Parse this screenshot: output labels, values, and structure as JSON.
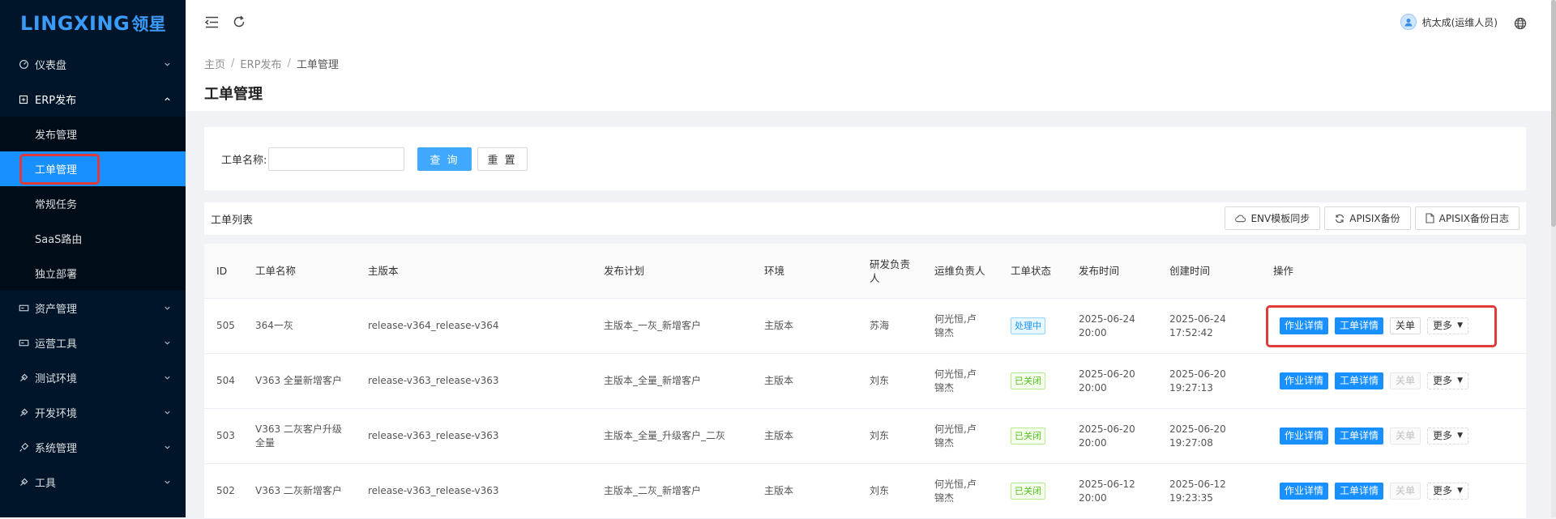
{
  "logo": {
    "text": "LINGXING",
    "cn": "领星"
  },
  "sidebar": {
    "items": [
      {
        "label": "仪表盘",
        "icon": "dashboard-icon",
        "expanded": false
      },
      {
        "label": "ERP发布",
        "icon": "erp-icon",
        "expanded": true,
        "children": [
          "发布管理",
          "工单管理",
          "常规任务",
          "SaaS路由",
          "独立部署"
        ],
        "active_child": "工单管理"
      },
      {
        "label": "资产管理",
        "icon": "asset-icon",
        "expanded": false
      },
      {
        "label": "运营工具",
        "icon": "ops-tool-icon",
        "expanded": false
      },
      {
        "label": "测试环境",
        "icon": "test-env-icon",
        "expanded": false
      },
      {
        "label": "开发环境",
        "icon": "dev-env-icon",
        "expanded": false
      },
      {
        "label": "系统管理",
        "icon": "system-icon",
        "expanded": false
      },
      {
        "label": "工具",
        "icon": "tools-icon",
        "expanded": false
      }
    ]
  },
  "header": {
    "user": "杭太成(运维人员)"
  },
  "breadcrumb": [
    "主页",
    "ERP发布",
    "工单管理"
  ],
  "page_title": "工单管理",
  "search": {
    "label": "工单名称:",
    "value": "",
    "query_btn": "查 询",
    "reset_btn": "重 置"
  },
  "toolbar": {
    "title": "工单列表",
    "buttons": [
      "ENV模板同步",
      "APISIX备份",
      "APISIX备份日志"
    ]
  },
  "table": {
    "columns": [
      "ID",
      "工单名称",
      "主版本",
      "发布计划",
      "环境",
      "研发负责人",
      "运维负责人",
      "工单状态",
      "发布时间",
      "创建时间",
      "操作"
    ],
    "rows": [
      {
        "id": "505",
        "name": "364一灰",
        "version": "release-v364_release-v364",
        "plan": "主版本_一灰_新增客户",
        "env": "主版本",
        "dev": "苏海",
        "ops": "何光恒,卢锦杰",
        "status": "处理中",
        "status_type": "proc",
        "release_time": "2025-06-24 20:00",
        "created": "2025-06-24 17:52:42",
        "close_disabled": false
      },
      {
        "id": "504",
        "name": "V363 全量新增客户",
        "version": "release-v363_release-v363",
        "plan": "主版本_全量_新增客户",
        "env": "主版本",
        "dev": "刘东",
        "ops": "何光恒,卢锦杰",
        "status": "已关闭",
        "status_type": "closed",
        "release_time": "2025-06-20 20:00",
        "created": "2025-06-20 19:27:13",
        "close_disabled": true
      },
      {
        "id": "503",
        "name": "V363 二灰客户升级全量",
        "version": "release-v363_release-v363",
        "plan": "主版本_全量_升级客户_二灰",
        "env": "主版本",
        "dev": "刘东",
        "ops": "何光恒,卢锦杰",
        "status": "已关闭",
        "status_type": "closed",
        "release_time": "2025-06-20 20:00",
        "created": "2025-06-20 19:27:08",
        "close_disabled": true
      },
      {
        "id": "502",
        "name": "V363 二灰新增客户",
        "version": "release-v363_release-v363",
        "plan": "主版本_二灰_新增客户",
        "env": "主版本",
        "dev": "刘东",
        "ops": "何光恒,卢锦杰",
        "status": "已关闭",
        "status_type": "closed",
        "release_time": "2025-06-12 20:00",
        "created": "2025-06-12 19:23:35",
        "close_disabled": true
      }
    ],
    "actions": {
      "job_detail": "作业详情",
      "order_detail": "工单详情",
      "close": "关单",
      "more": "更多"
    }
  },
  "colors": {
    "sidebar_bg": "#001529",
    "primary": "#1890ff",
    "highlight": "#e03a3a"
  }
}
